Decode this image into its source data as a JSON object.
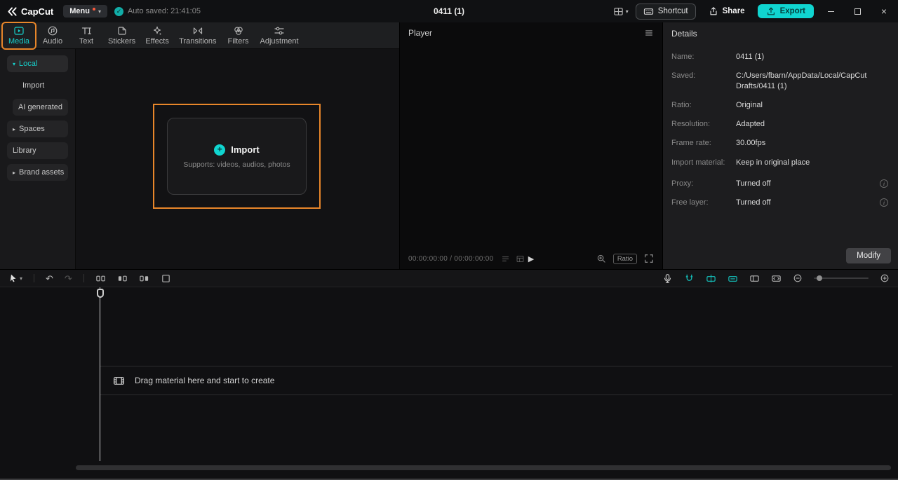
{
  "titlebar": {
    "logo_text": "CapCut",
    "menu_label": "Menu",
    "autosave_label": "Auto saved: 21:41:05",
    "doc_title": "0411 (1)",
    "shortcut_label": "Shortcut",
    "share_label": "Share",
    "export_label": "Export"
  },
  "tabs": [
    {
      "label": "Media"
    },
    {
      "label": "Audio"
    },
    {
      "label": "Text"
    },
    {
      "label": "Stickers"
    },
    {
      "label": "Effects"
    },
    {
      "label": "Transitions"
    },
    {
      "label": "Filters"
    },
    {
      "label": "Adjustment"
    }
  ],
  "sidebar": [
    {
      "label": "Local"
    },
    {
      "label": "Import"
    },
    {
      "label": "AI generated"
    },
    {
      "label": "Spaces"
    },
    {
      "label": "Library"
    },
    {
      "label": "Brand assets"
    }
  ],
  "media": {
    "import_label": "Import",
    "import_hint": "Supports: videos, audios, photos"
  },
  "player": {
    "title": "Player",
    "time_display": "00:00:00:00 / 00:00:00:00",
    "ratio_label": "Ratio"
  },
  "details": {
    "title": "Details",
    "rows": [
      {
        "label": "Name:",
        "value": "0411 (1)"
      },
      {
        "label": "Saved:",
        "value": "C:/Users/fbarn/AppData/Local/CapCut Drafts/0411 (1)"
      },
      {
        "label": "Ratio:",
        "value": "Original"
      },
      {
        "label": "Resolution:",
        "value": "Adapted"
      },
      {
        "label": "Frame rate:",
        "value": "30.00fps"
      },
      {
        "label": "Import material:",
        "value": "Keep in original place"
      },
      {
        "label": "Proxy:",
        "value": "Turned off"
      },
      {
        "label": "Free layer:",
        "value": "Turned off"
      }
    ],
    "modify_label": "Modify"
  },
  "timeline": {
    "empty_message": "Drag material here and start to create"
  },
  "icons": {
    "caret_down": "▾",
    "caret_right": "▸",
    "check": "✓",
    "play": "▶",
    "plus": "+",
    "undo": "↶",
    "redo": "↷",
    "close": "×",
    "info": "i"
  },
  "colors": {
    "accent": "#10d5d0",
    "highlight_orange": "#e8862a",
    "background": "#101012"
  }
}
